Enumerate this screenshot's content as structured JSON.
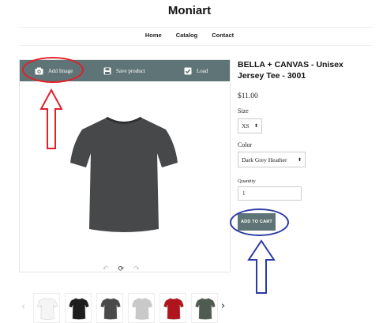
{
  "site": {
    "title": "Moniart"
  },
  "nav": [
    {
      "label": "Home"
    },
    {
      "label": "Catalog"
    },
    {
      "label": "Contact"
    }
  ],
  "toolbar": {
    "add_image": "Add Image",
    "save_product": "Save product",
    "load": "Load"
  },
  "product": {
    "title": "BELLA + CANVAS - Unisex Jersey Tee - 3001",
    "price": "$11.00",
    "size_label": "Size",
    "size_value": "XS",
    "color_label": "Color",
    "color_value": "Dark Grey Heather",
    "quantity_label": "Quantity",
    "quantity_value": "1",
    "add_to_cart": "ADD TO CART",
    "shirt_color": "#474849"
  },
  "thumbnails": [
    {
      "color": "#f5f5f5"
    },
    {
      "color": "#1e1e1e"
    },
    {
      "color": "#4a4a4a"
    },
    {
      "color": "#c9c9c9"
    },
    {
      "color": "#b0141c"
    },
    {
      "color": "#4f5a50"
    }
  ],
  "annotations": {
    "ring_color": "#e0202a",
    "ring_color_blue": "#2c3aa6"
  }
}
